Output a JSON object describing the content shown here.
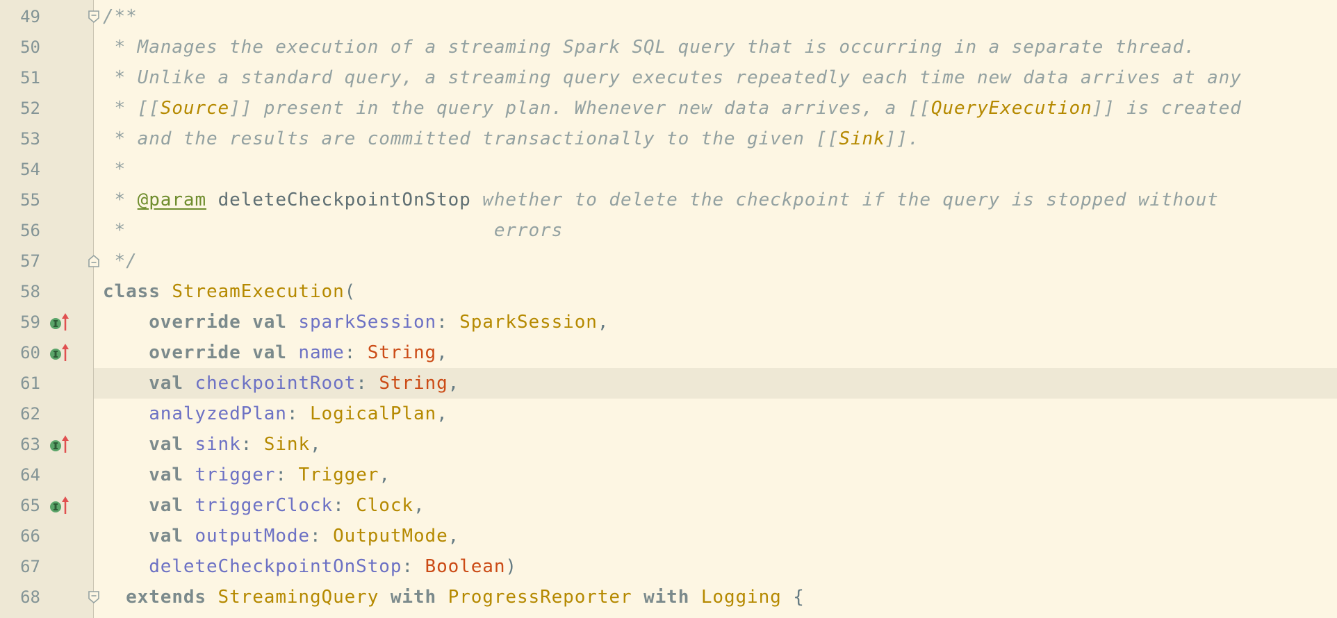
{
  "editor": {
    "colors": {
      "background": "#fdf6e3",
      "gutter": "#eee8d5",
      "current_line": "#eee8d5",
      "comment": "#93a1a1",
      "keyword": "#7b8a8c",
      "type": "#b58900",
      "field": "#6c71c4",
      "string_type": "#cb4b16",
      "marker_green": "#5aa469",
      "marker_red": "#e05050"
    },
    "lines": [
      {
        "num": "49",
        "fold": "fold-open",
        "marker": false,
        "current": false,
        "tokens": [
          {
            "t": "/**",
            "k": "cmt"
          }
        ]
      },
      {
        "num": "50",
        "fold": "",
        "marker": false,
        "current": false,
        "tokens": [
          {
            "t": " * Manages the execution of a streaming Spark SQL query that is occurring in a separate thread.",
            "k": "cmt"
          }
        ]
      },
      {
        "num": "51",
        "fold": "",
        "marker": false,
        "current": false,
        "tokens": [
          {
            "t": " * Unlike a standard query, a streaming query executes repeatedly each time new data arrives at any",
            "k": "cmt"
          }
        ]
      },
      {
        "num": "52",
        "fold": "",
        "marker": false,
        "current": false,
        "tokens": [
          {
            "t": " * [[",
            "k": "cmt"
          },
          {
            "t": "Source",
            "k": "ref"
          },
          {
            "t": "]] present in the query plan. Whenever new data arrives, a [[",
            "k": "cmt"
          },
          {
            "t": "QueryExecution",
            "k": "ref"
          },
          {
            "t": "]] is created",
            "k": "cmt"
          }
        ]
      },
      {
        "num": "53",
        "fold": "",
        "marker": false,
        "current": false,
        "tokens": [
          {
            "t": " * and the results are committed transactionally to the given [[",
            "k": "cmt"
          },
          {
            "t": "Sink",
            "k": "ref"
          },
          {
            "t": "]].",
            "k": "cmt"
          }
        ]
      },
      {
        "num": "54",
        "fold": "",
        "marker": false,
        "current": false,
        "tokens": [
          {
            "t": " *",
            "k": "cmt"
          }
        ]
      },
      {
        "num": "55",
        "fold": "",
        "marker": false,
        "current": false,
        "tokens": [
          {
            "t": " * ",
            "k": "cmt"
          },
          {
            "t": "@param",
            "k": "tag"
          },
          {
            "t": " ",
            "k": "cmt"
          },
          {
            "t": "deleteCheckpointOnStop",
            "k": "pname"
          },
          {
            "t": " whether to delete the checkpoint if the query is stopped without",
            "k": "cmt"
          }
        ]
      },
      {
        "num": "56",
        "fold": "",
        "marker": false,
        "current": false,
        "tokens": [
          {
            "t": " *                                errors",
            "k": "cmt"
          }
        ]
      },
      {
        "num": "57",
        "fold": "fold-close",
        "marker": false,
        "current": false,
        "tokens": [
          {
            "t": " */",
            "k": "cmt"
          }
        ]
      },
      {
        "num": "58",
        "fold": "",
        "marker": false,
        "current": false,
        "tokens": [
          {
            "t": "class",
            "k": "kw"
          },
          {
            "t": " ",
            "k": "pun"
          },
          {
            "t": "StreamExecution",
            "k": "cls"
          },
          {
            "t": "(",
            "k": "pun"
          }
        ]
      },
      {
        "num": "59",
        "fold": "",
        "marker": true,
        "current": false,
        "tokens": [
          {
            "t": "    ",
            "k": "pun"
          },
          {
            "t": "override val",
            "k": "kw"
          },
          {
            "t": " ",
            "k": "pun"
          },
          {
            "t": "sparkSession",
            "k": "fld"
          },
          {
            "t": ": ",
            "k": "pun"
          },
          {
            "t": "SparkSession",
            "k": "cls"
          },
          {
            "t": ",",
            "k": "pun"
          }
        ]
      },
      {
        "num": "60",
        "fold": "",
        "marker": true,
        "current": false,
        "tokens": [
          {
            "t": "    ",
            "k": "pun"
          },
          {
            "t": "override val",
            "k": "kw"
          },
          {
            "t": " ",
            "k": "pun"
          },
          {
            "t": "name",
            "k": "fld"
          },
          {
            "t": ": ",
            "k": "pun"
          },
          {
            "t": "String",
            "k": "str"
          },
          {
            "t": ",",
            "k": "pun"
          }
        ]
      },
      {
        "num": "61",
        "fold": "",
        "marker": false,
        "current": true,
        "tokens": [
          {
            "t": "    ",
            "k": "pun"
          },
          {
            "t": "val",
            "k": "kw"
          },
          {
            "t": " ",
            "k": "pun"
          },
          {
            "t": "checkpointRoot",
            "k": "fld"
          },
          {
            "t": ": ",
            "k": "pun"
          },
          {
            "t": "String",
            "k": "str"
          },
          {
            "t": ",",
            "k": "pun"
          }
        ]
      },
      {
        "num": "62",
        "fold": "",
        "marker": false,
        "current": false,
        "tokens": [
          {
            "t": "    ",
            "k": "pun"
          },
          {
            "t": "analyzedPlan",
            "k": "fld"
          },
          {
            "t": ": ",
            "k": "pun"
          },
          {
            "t": "LogicalPlan",
            "k": "cls"
          },
          {
            "t": ",",
            "k": "pun"
          }
        ]
      },
      {
        "num": "63",
        "fold": "",
        "marker": true,
        "current": false,
        "tokens": [
          {
            "t": "    ",
            "k": "pun"
          },
          {
            "t": "val",
            "k": "kw"
          },
          {
            "t": " ",
            "k": "pun"
          },
          {
            "t": "sink",
            "k": "fld"
          },
          {
            "t": ": ",
            "k": "pun"
          },
          {
            "t": "Sink",
            "k": "cls"
          },
          {
            "t": ",",
            "k": "pun"
          }
        ]
      },
      {
        "num": "64",
        "fold": "",
        "marker": false,
        "current": false,
        "tokens": [
          {
            "t": "    ",
            "k": "pun"
          },
          {
            "t": "val",
            "k": "kw"
          },
          {
            "t": " ",
            "k": "pun"
          },
          {
            "t": "trigger",
            "k": "fld"
          },
          {
            "t": ": ",
            "k": "pun"
          },
          {
            "t": "Trigger",
            "k": "cls"
          },
          {
            "t": ",",
            "k": "pun"
          }
        ]
      },
      {
        "num": "65",
        "fold": "",
        "marker": true,
        "current": false,
        "tokens": [
          {
            "t": "    ",
            "k": "pun"
          },
          {
            "t": "val",
            "k": "kw"
          },
          {
            "t": " ",
            "k": "pun"
          },
          {
            "t": "triggerClock",
            "k": "fld"
          },
          {
            "t": ": ",
            "k": "pun"
          },
          {
            "t": "Clock",
            "k": "cls"
          },
          {
            "t": ",",
            "k": "pun"
          }
        ]
      },
      {
        "num": "66",
        "fold": "",
        "marker": false,
        "current": false,
        "tokens": [
          {
            "t": "    ",
            "k": "pun"
          },
          {
            "t": "val",
            "k": "kw"
          },
          {
            "t": " ",
            "k": "pun"
          },
          {
            "t": "outputMode",
            "k": "fld"
          },
          {
            "t": ": ",
            "k": "pun"
          },
          {
            "t": "OutputMode",
            "k": "cls"
          },
          {
            "t": ",",
            "k": "pun"
          }
        ]
      },
      {
        "num": "67",
        "fold": "",
        "marker": false,
        "current": false,
        "tokens": [
          {
            "t": "    ",
            "k": "pun"
          },
          {
            "t": "deleteCheckpointOnStop",
            "k": "fld"
          },
          {
            "t": ": ",
            "k": "pun"
          },
          {
            "t": "Boolean",
            "k": "str"
          },
          {
            "t": ")",
            "k": "pun"
          }
        ]
      },
      {
        "num": "68",
        "fold": "fold-open",
        "marker": false,
        "current": false,
        "tokens": [
          {
            "t": "  ",
            "k": "pun"
          },
          {
            "t": "extends",
            "k": "kw"
          },
          {
            "t": " ",
            "k": "pun"
          },
          {
            "t": "StreamingQuery",
            "k": "cls"
          },
          {
            "t": " ",
            "k": "pun"
          },
          {
            "t": "with",
            "k": "kw"
          },
          {
            "t": " ",
            "k": "pun"
          },
          {
            "t": "ProgressReporter",
            "k": "cls"
          },
          {
            "t": " ",
            "k": "pun"
          },
          {
            "t": "with",
            "k": "kw"
          },
          {
            "t": " ",
            "k": "pun"
          },
          {
            "t": "Logging",
            "k": "cls"
          },
          {
            "t": " {",
            "k": "pun"
          }
        ]
      }
    ]
  }
}
